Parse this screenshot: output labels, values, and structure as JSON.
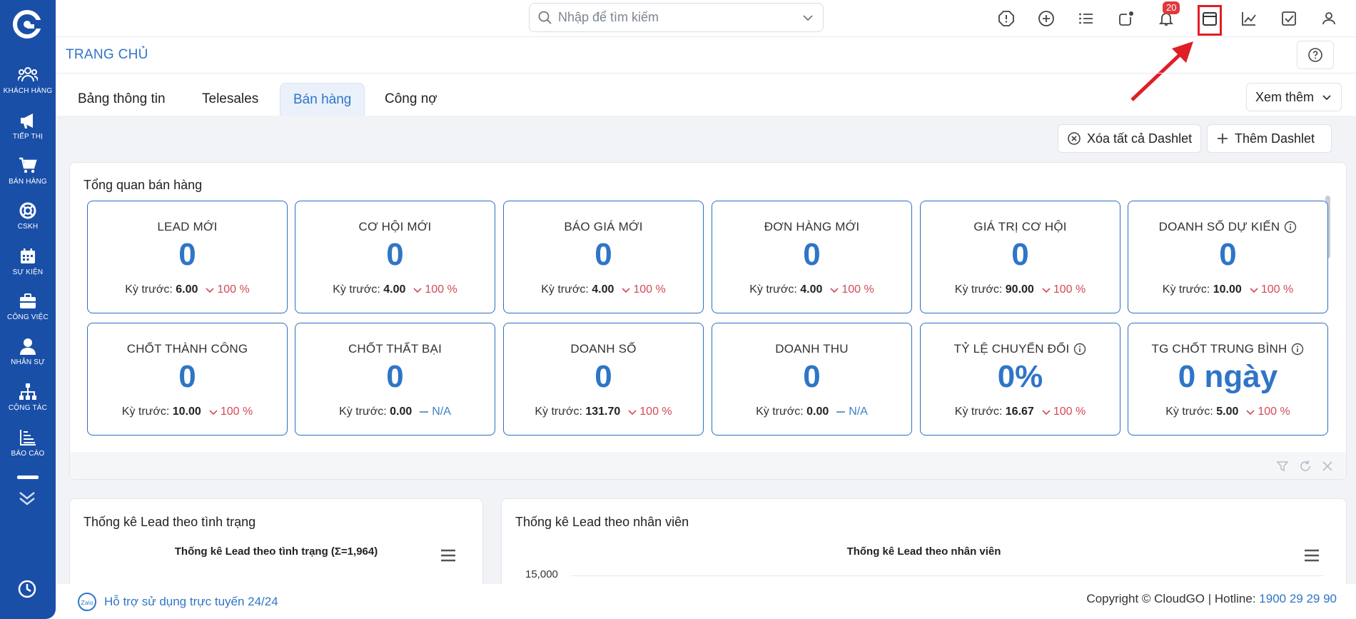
{
  "sidebar": {
    "items": [
      {
        "label": "KHÁCH HÀNG",
        "icon": "users-icon"
      },
      {
        "label": "TIẾP THỊ",
        "icon": "megaphone-icon"
      },
      {
        "label": "BÁN HÀNG",
        "icon": "cart-icon"
      },
      {
        "label": "CSKH",
        "icon": "lifebuoy-icon"
      },
      {
        "label": "SỰ KIỆN",
        "icon": "calendar-icon"
      },
      {
        "label": "CÔNG VIỆC",
        "icon": "briefcase-icon"
      },
      {
        "label": "NHÂN SỰ",
        "icon": "person-icon"
      },
      {
        "label": "CỘNG TÁC",
        "icon": "org-chart-icon"
      },
      {
        "label": "BÁO CÁO",
        "icon": "bar-chart-icon"
      }
    ]
  },
  "topbar": {
    "search_placeholder": "Nhập để tìm kiếm",
    "notification_count": "20"
  },
  "header": {
    "title": "TRANG CHỦ"
  },
  "tabs": [
    {
      "label": "Bảng thông tin",
      "active": false
    },
    {
      "label": "Telesales",
      "active": false
    },
    {
      "label": "Bán hàng",
      "active": true
    },
    {
      "label": "Công nợ",
      "active": false
    }
  ],
  "more_label": "Xem thêm",
  "actions": {
    "clear_label": "Xóa tất cả Dashlet",
    "add_label": "Thêm Dashlet"
  },
  "overview": {
    "title": "Tổng quan bán hàng",
    "prev_label": "Kỳ trước:",
    "cards": [
      {
        "title": "LEAD MỚI",
        "value": "0",
        "prev": "6.00",
        "change": "100 %",
        "trend": "down",
        "info": false
      },
      {
        "title": "CƠ HỘI MỚI",
        "value": "0",
        "prev": "4.00",
        "change": "100 %",
        "trend": "down",
        "info": false
      },
      {
        "title": "BÁO GIÁ MỚI",
        "value": "0",
        "prev": "4.00",
        "change": "100 %",
        "trend": "down",
        "info": false
      },
      {
        "title": "ĐƠN HÀNG MỚI",
        "value": "0",
        "prev": "4.00",
        "change": "100 %",
        "trend": "down",
        "info": false
      },
      {
        "title": "GIÁ TRỊ CƠ HỘI",
        "value": "0",
        "prev": "90.00",
        "change": "100 %",
        "trend": "down",
        "info": false
      },
      {
        "title": "DOANH SỐ DỰ KIẾN",
        "value": "0",
        "prev": "10.00",
        "change": "100 %",
        "trend": "down",
        "info": true
      },
      {
        "title": "CHỐT THÀNH CÔNG",
        "value": "0",
        "prev": "10.00",
        "change": "100 %",
        "trend": "down",
        "info": false
      },
      {
        "title": "CHỐT THẤT BẠI",
        "value": "0",
        "prev": "0.00",
        "change": "N/A",
        "trend": "flat",
        "info": false
      },
      {
        "title": "DOANH SỐ",
        "value": "0",
        "prev": "131.70",
        "change": "100 %",
        "trend": "down",
        "info": false
      },
      {
        "title": "DOANH THU",
        "value": "0",
        "prev": "0.00",
        "change": "N/A",
        "trend": "flat",
        "info": false
      },
      {
        "title": "TỶ LỆ CHUYỂN ĐỔI",
        "value": "0%",
        "prev": "16.67",
        "change": "100 %",
        "trend": "down",
        "info": true
      },
      {
        "title": "TG CHỐT TRUNG BÌNH",
        "value": "0 ngày",
        "prev": "5.00",
        "change": "100 %",
        "trend": "down",
        "info": true
      }
    ]
  },
  "charts": {
    "status": {
      "head": "Thống kê Lead theo tình trạng",
      "sub": "Thống kê Lead theo tình trạng (Σ=1,964)"
    },
    "staff": {
      "head": "Thống kê Lead theo nhân viên",
      "sub": "Thống kê Lead theo nhân viên",
      "ytick": "15,000"
    }
  },
  "footer": {
    "support": "Hỗ trợ sử dụng trực tuyến 24/24",
    "copyright": "Copyright © CloudGO",
    "hotline_label": "Hotline:",
    "hotline": "1900 29 29 90"
  },
  "colors": {
    "sidebar": "#1a4fa8",
    "accent": "#2f75c7",
    "down": "#d24b57",
    "highlight": "#e01e25"
  }
}
